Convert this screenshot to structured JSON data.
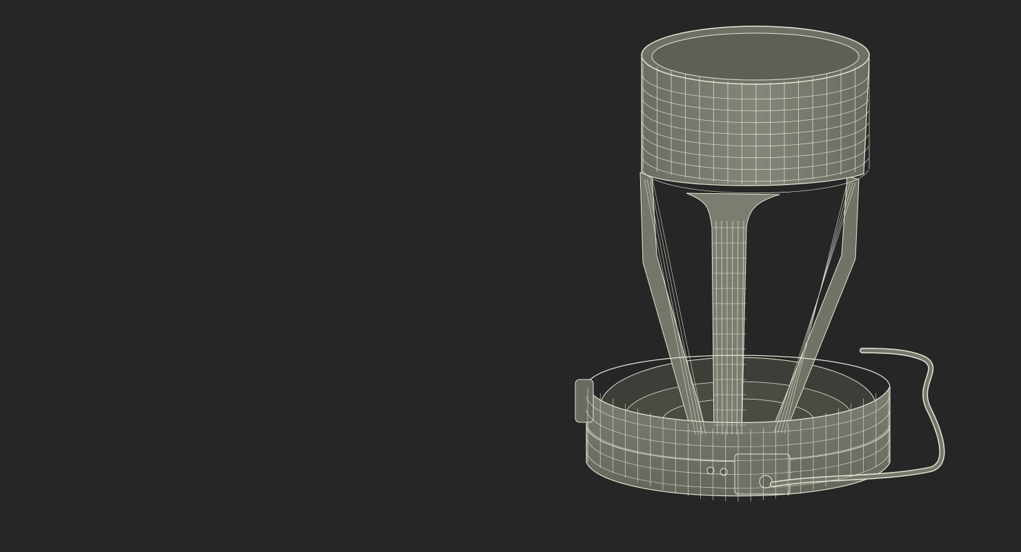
{
  "scene": {
    "background_color": "#262626",
    "mesh_fill_color": "#7a7a6e",
    "mesh_dark_color": "#55554c",
    "wire_color": "#e8e8d8"
  }
}
